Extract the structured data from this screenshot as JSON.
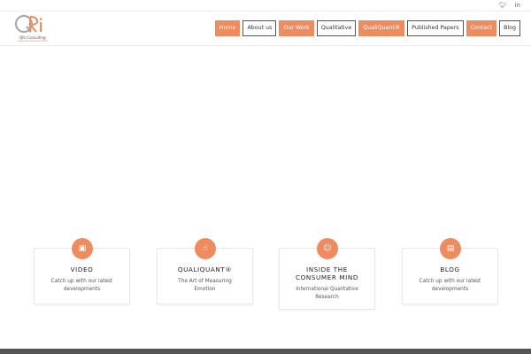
{
  "social": [
    {
      "label": "ὂ6",
      "glyph": "✤",
      "name": "twitter-icon"
    },
    {
      "label": "in",
      "name": "linkedin-icon"
    }
  ],
  "brand": {
    "name": "QRi Consulting",
    "tagline": "Inside the Consumer Mind",
    "colors": {
      "accent": "#ef8c5f",
      "logo_gray": "#aaaaaa"
    }
  },
  "nav": [
    {
      "label": "Home",
      "style": "orange"
    },
    {
      "label": "About us",
      "style": "outline"
    },
    {
      "label": "Our Work",
      "style": "orange"
    },
    {
      "label": "Qualitative",
      "style": "outline"
    },
    {
      "label": "QualiQuant®",
      "style": "orange"
    },
    {
      "label": "Published Papers",
      "style": "outline"
    },
    {
      "label": "Contact",
      "style": "orange"
    },
    {
      "label": "Blog",
      "style": "outline"
    }
  ],
  "features": [
    {
      "icon": "video-icon",
      "glyph": "▣",
      "title": "VIDEO",
      "text": "Catch up with our latest developments"
    },
    {
      "icon": "thumbs-up-icon",
      "glyph": "☝",
      "title": "QUALIQUANT®",
      "text": "The Art of Measuring Emotion"
    },
    {
      "icon": "user-icon",
      "glyph": "☺",
      "title": "INSIDE THE CONSUMER MIND",
      "text": "International Qualitative Research"
    },
    {
      "icon": "blog-icon",
      "glyph": "▤",
      "title": "BLOG",
      "text": "Catch up with our latest developments"
    }
  ]
}
